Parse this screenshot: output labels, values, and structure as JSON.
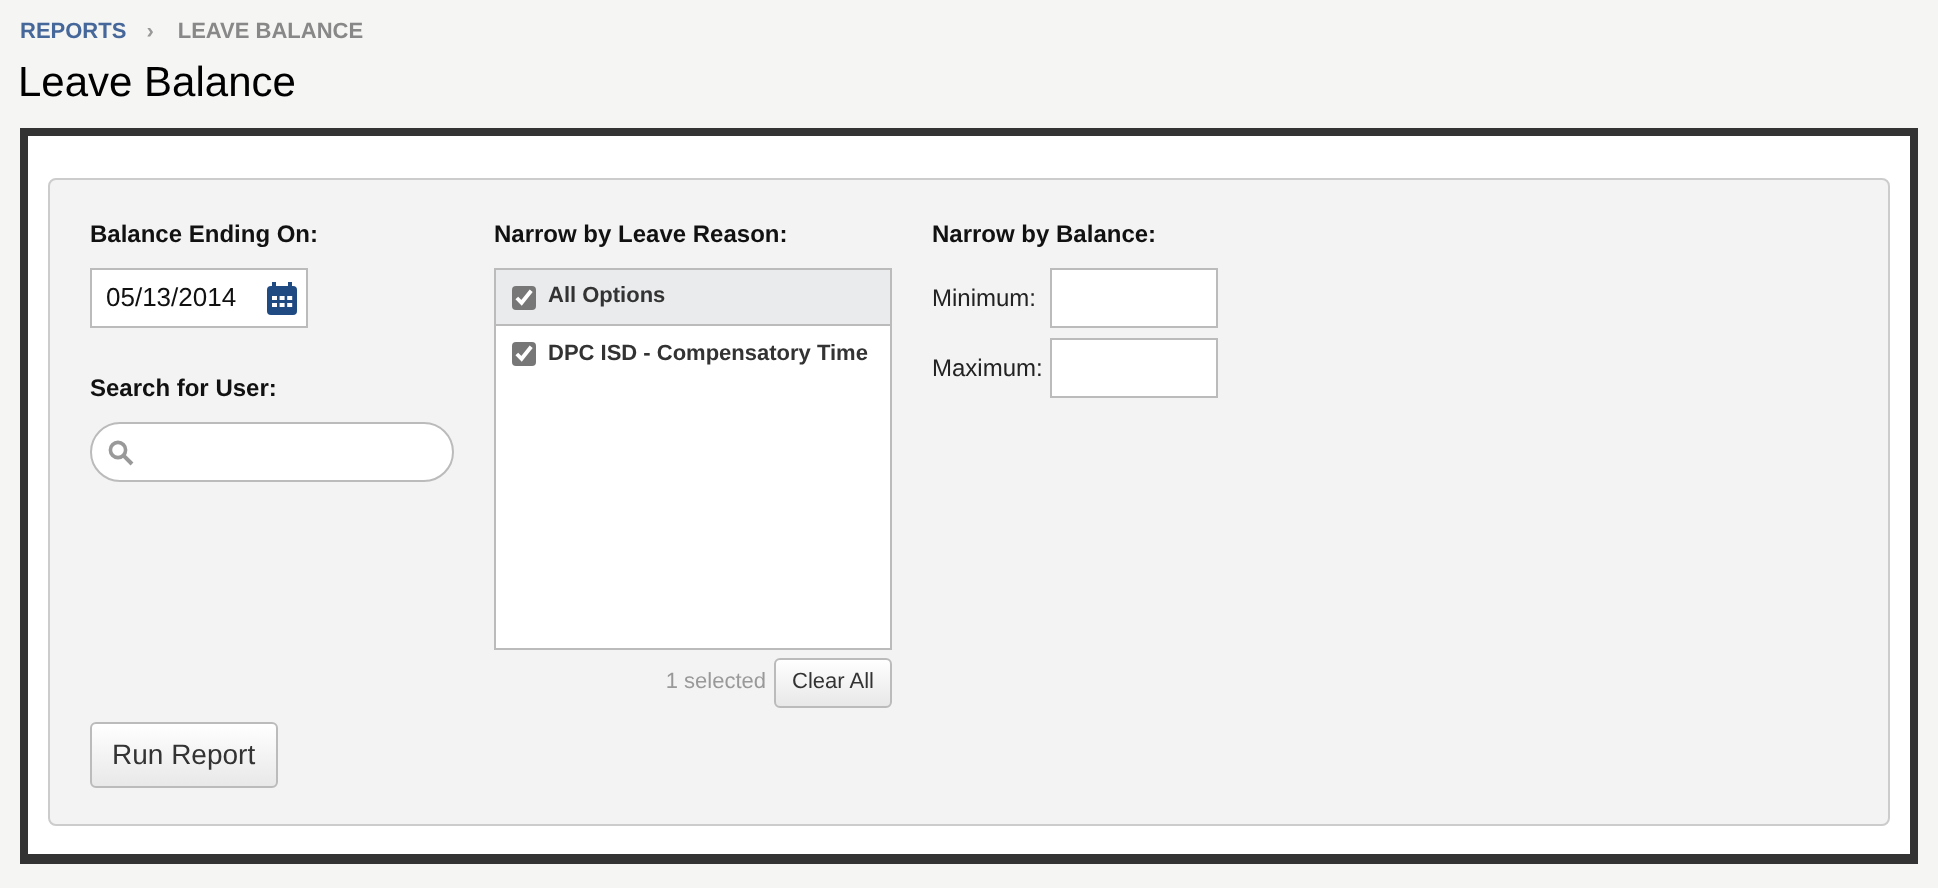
{
  "breadcrumb": [
    {
      "label": "REPORTS",
      "link": true
    },
    {
      "label": "LEAVE BALANCE",
      "link": false
    }
  ],
  "breadcrumb_separator": "›",
  "title": "Leave Balance",
  "balance_ending": {
    "label": "Balance Ending On:",
    "value": "05/13/2014"
  },
  "search_user": {
    "label": "Search for User:"
  },
  "leave_reason": {
    "label": "Narrow by Leave Reason:",
    "options": [
      {
        "label": "All Options",
        "checked": true,
        "kind": "header"
      },
      {
        "label": "DPC ISD - Compensatory Time",
        "checked": true,
        "kind": "item"
      }
    ],
    "count": "1 selected",
    "clear_button": "Clear All"
  },
  "balance": {
    "label": "Narrow by Balance:",
    "fields": [
      {
        "label": "Minimum:"
      },
      {
        "label": "Maximum:"
      }
    ]
  },
  "run_button": "Run Report"
}
